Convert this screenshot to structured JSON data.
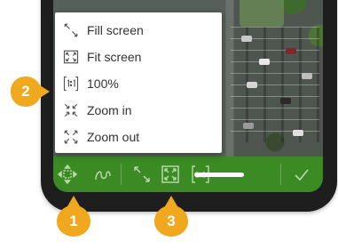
{
  "colors": {
    "toolbar": "#3b8a24",
    "toolbar_icon": "#b8d9a8",
    "callout": "#f0a91f",
    "menu_text": "#333333",
    "menu_icon": "#555555",
    "frame": "#1e1e1e"
  },
  "menu": {
    "items": [
      {
        "label": "Fill screen",
        "icon": "fill-screen-icon"
      },
      {
        "label": "Fit screen",
        "icon": "fit-screen-icon"
      },
      {
        "label": "100%",
        "icon": "actual-size-icon"
      },
      {
        "label": "Zoom in",
        "icon": "zoom-in-icon"
      },
      {
        "label": "Zoom out",
        "icon": "zoom-out-icon"
      }
    ]
  },
  "toolbar": {
    "buttons": [
      {
        "icon": "pan-move-icon"
      },
      {
        "icon": "freehand-icon"
      },
      {
        "icon": "fill-screen-icon"
      },
      {
        "icon": "fit-screen-icon"
      },
      {
        "icon": "actual-size-icon",
        "label": "1:1"
      },
      {
        "icon": "check-icon"
      }
    ]
  },
  "callouts": [
    "1",
    "2",
    "3"
  ]
}
